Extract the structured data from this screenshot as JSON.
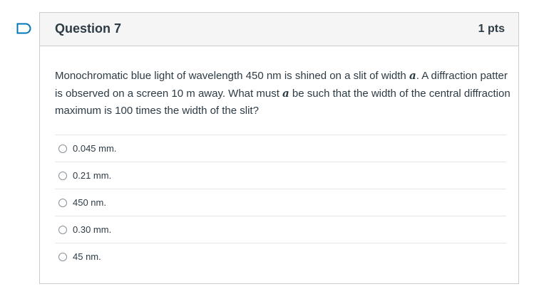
{
  "question": {
    "title": "Question 7",
    "points": "1 pts",
    "text_part1": "Monochromatic blue light of wavelength 450 nm is shined on a slit of width ",
    "var_a": "a",
    "text_part2": ".  A diffraction patter is observed on a screen 10 m away.  What must ",
    "var_a2": "a",
    "text_part3": " be such that the width of the central diffraction maximum is 100 times the width of the slit?"
  },
  "answers": [
    {
      "label": "0.045 mm."
    },
    {
      "label": "0.21 mm."
    },
    {
      "label": "450 nm."
    },
    {
      "label": "0.30 mm."
    },
    {
      "label": "45 nm."
    }
  ],
  "colors": {
    "accent": "#0374b5",
    "text": "#2d3b45",
    "border": "#c7cdd1",
    "header_bg": "#f5f5f5"
  },
  "icons": {
    "flag": "bookmark-flag-icon"
  }
}
